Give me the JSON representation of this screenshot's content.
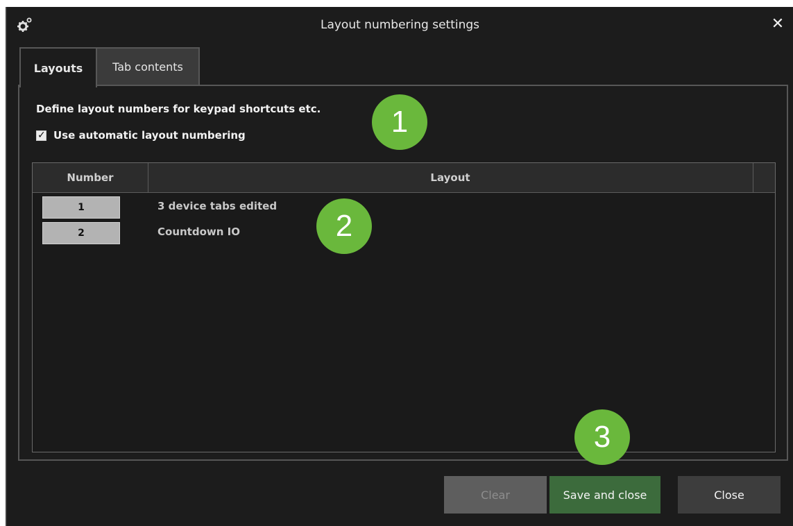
{
  "dialog": {
    "title": "Layout numbering settings",
    "close_symbol": "✕",
    "title_icon": "gears-icon"
  },
  "tabs": [
    {
      "label": "Layouts",
      "active": true
    },
    {
      "label": "Tab contents",
      "active": false
    }
  ],
  "layouts_tab": {
    "description": "Define layout numbers for keypad shortcuts etc.",
    "auto_numbering": {
      "label": "Use automatic layout numbering",
      "checked": true
    },
    "table": {
      "columns": [
        "Number",
        "Layout"
      ],
      "rows": [
        {
          "number": "1",
          "layout": "3 device tabs edited"
        },
        {
          "number": "2",
          "layout": "Countdown IO"
        }
      ]
    }
  },
  "badges": [
    "1",
    "2",
    "3"
  ],
  "footer": {
    "clear_label": "Clear",
    "save_label": "Save and close",
    "close_label": "Close"
  },
  "colors": {
    "background": "#1c1c1c",
    "badge": "#6ab83c",
    "save_button": "#3c6b3c"
  }
}
